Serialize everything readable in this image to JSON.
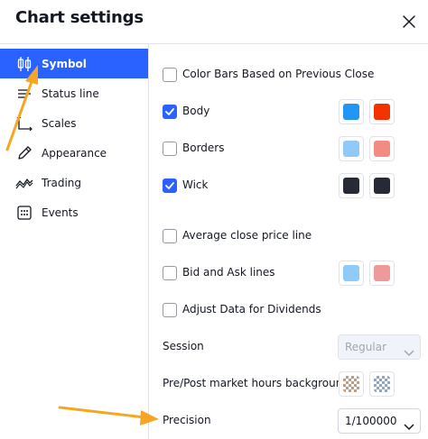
{
  "header": {
    "title": "Chart settings"
  },
  "sidebar": {
    "items": [
      {
        "label": "Symbol",
        "icon": "candlestick-icon",
        "active": true
      },
      {
        "label": "Status line",
        "icon": "status-line-icon"
      },
      {
        "label": "Scales",
        "icon": "scales-icon"
      },
      {
        "label": "Appearance",
        "icon": "pencil-icon"
      },
      {
        "label": "Trading",
        "icon": "trading-icon"
      },
      {
        "label": "Events",
        "icon": "calendar-icon"
      }
    ]
  },
  "symbol": {
    "color_bars": {
      "label": "Color Bars Based on Previous Close",
      "checked": false
    },
    "body": {
      "label": "Body",
      "checked": true,
      "colors": [
        "#2196f3",
        "#f23300"
      ]
    },
    "borders": {
      "label": "Borders",
      "checked": false,
      "colors": [
        "#90caf9",
        "#f28b82"
      ]
    },
    "wick": {
      "label": "Wick",
      "checked": true,
      "colors": [
        "#252a36",
        "#252a36"
      ]
    },
    "avg_close": {
      "label": "Average close price line",
      "checked": false
    },
    "bid_ask": {
      "label": "Bid and Ask lines",
      "checked": false,
      "colors": [
        "#90caf9",
        "#ef9a9a"
      ]
    },
    "dividends": {
      "label": "Adjust Data for Dividends",
      "checked": false
    },
    "session": {
      "label": "Session",
      "value": "Regular",
      "disabled": true
    },
    "pre_post": {
      "label": "Pre/Post market hours background"
    },
    "precision": {
      "label": "Precision",
      "value": "1/100000"
    }
  },
  "colors": {
    "accent": "#2962ff",
    "annotation_arrow": "#f5a623"
  }
}
